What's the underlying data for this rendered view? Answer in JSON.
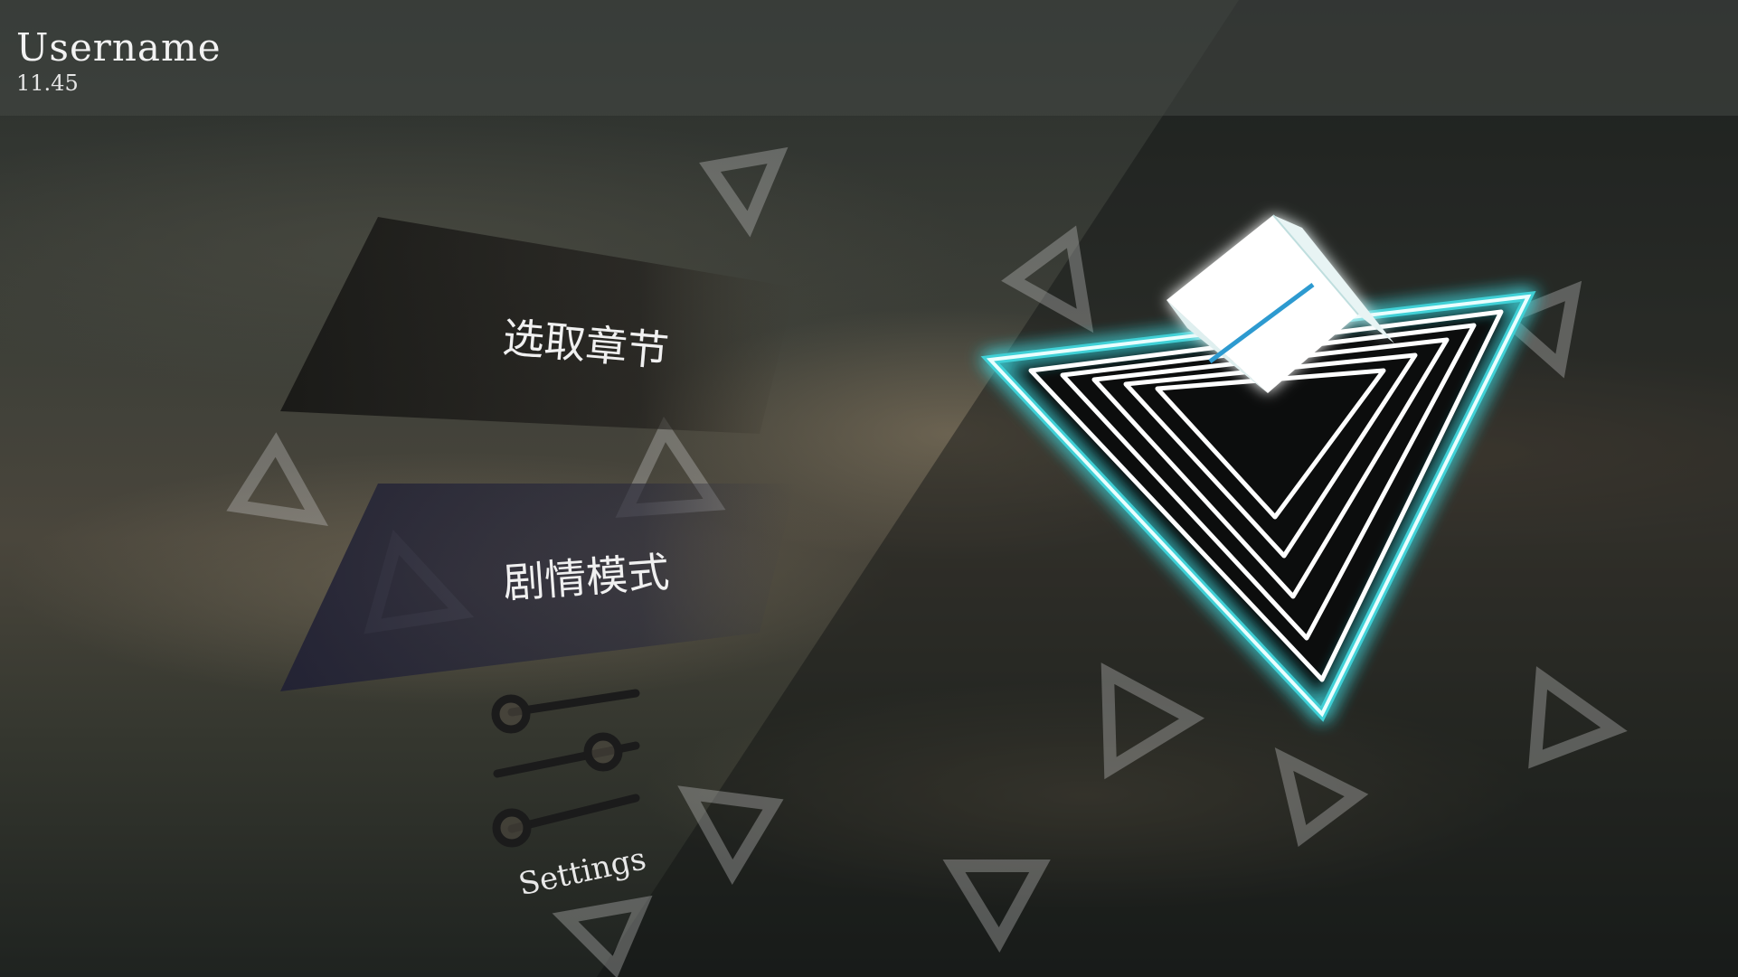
{
  "header": {
    "username": "Username",
    "score": "11.45"
  },
  "menu": {
    "select_chapter": "选取章节",
    "story_mode": "剧情模式",
    "settings": "Settings"
  },
  "icons": {
    "logo": "glowing-triangle-cube-logo-icon",
    "settings": "sliders-icon",
    "decor": "outline-triangle-icon"
  },
  "colors": {
    "glow": "#3fd0d6",
    "text": "#f0f0f0"
  }
}
